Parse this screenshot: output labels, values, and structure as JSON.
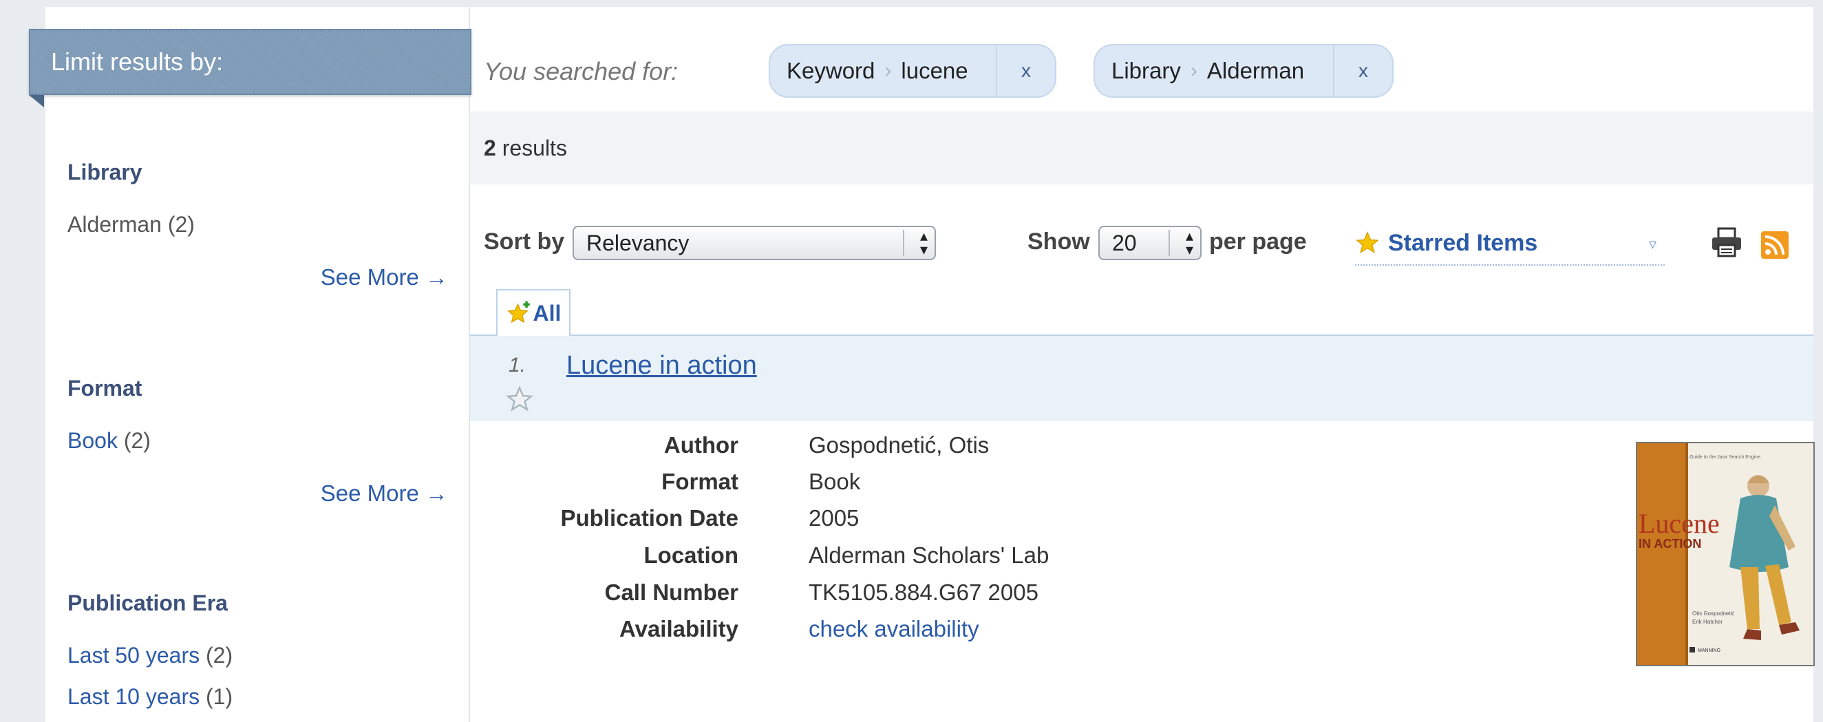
{
  "sidebar": {
    "header": "Limit results by:",
    "facets": [
      {
        "title": "Library",
        "items": [
          {
            "label": "Alderman",
            "count": "(2)"
          }
        ],
        "see_more": "See More →"
      },
      {
        "title": "Format",
        "items": [
          {
            "label": "Book",
            "count": "(2)"
          }
        ],
        "see_more": "See More →"
      },
      {
        "title": "Publication Era",
        "items": [
          {
            "label": "Last 50 years",
            "count": "(2)"
          },
          {
            "label": "Last 10 years",
            "count": "(1)"
          }
        ]
      }
    ]
  },
  "search": {
    "label": "You searched for:",
    "chips": [
      {
        "field": "Keyword",
        "separator": "›",
        "value": "lucene",
        "remove": "x"
      },
      {
        "field": "Library",
        "separator": "›",
        "value": "Alderman",
        "remove": "x"
      }
    ]
  },
  "results": {
    "count": "2",
    "suffix": " results"
  },
  "controls": {
    "sort_label": "Sort by",
    "sort_value": "Relevancy",
    "show_label": "Show",
    "show_value": "20",
    "per_page_label": "per page",
    "starred_label": "Starred Items",
    "select_arrows": "▴▾",
    "dropdown_arrow": "▿"
  },
  "tabs": [
    {
      "label": "All"
    }
  ],
  "result": {
    "number": "1.",
    "title": "Lucene in action",
    "fields": [
      {
        "label": "Author",
        "value": "Gospodnetić, Otis"
      },
      {
        "label": "Format",
        "value": "Book"
      },
      {
        "label": "Publication Date",
        "value": "2005"
      },
      {
        "label": "Location",
        "value": "Alderman Scholars' Lab"
      },
      {
        "label": "Call Number",
        "value": "TK5105.884.G67 2005"
      },
      {
        "label": "Availability",
        "value": "check availability",
        "link": true
      }
    ],
    "cover": {
      "title_line1": "Lucene",
      "title_line2": "IN ACTION"
    }
  },
  "colors": {
    "link": "#2b5aa8",
    "header_bg": "#7f9cb9",
    "result_bg": "#e8f2f8",
    "star": "#f5c400",
    "rss": "#f39a1e"
  }
}
